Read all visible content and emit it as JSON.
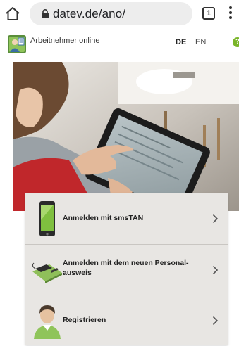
{
  "browser": {
    "url": "datev.de/ano/",
    "tab_count": "1",
    "icons": {
      "home": "home-icon",
      "lock": "lock-icon",
      "menu": "kebab-menu-icon"
    }
  },
  "header": {
    "brand": "Arbeitnehmer online",
    "languages": [
      "DE",
      "EN"
    ],
    "active_language": "DE",
    "help_symbol": "?"
  },
  "menu": {
    "items": [
      {
        "label": "Anmelden mit smsTAN",
        "icon": "smartphone-icon"
      },
      {
        "label": "Anmelden mit dem neuen Personal-ausweis",
        "icon": "id-card-reader-icon"
      },
      {
        "label": "Registrieren",
        "icon": "person-icon"
      }
    ]
  },
  "colors": {
    "accent_green": "#7ab529",
    "menu_background": "#e8e6e3",
    "urlbar_background": "#ededed"
  }
}
